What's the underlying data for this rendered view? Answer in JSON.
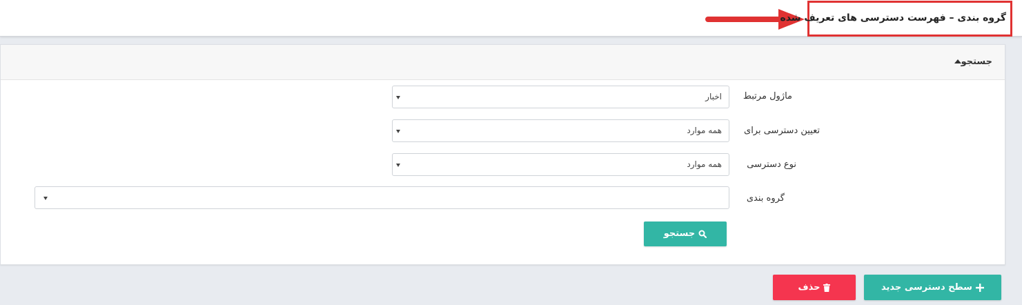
{
  "header": {
    "title": "گروه بندی – فهرست دسترسی های تعریف شده",
    "annotation_color": "#e03232"
  },
  "search_panel": {
    "title": "جستجو",
    "fields": [
      {
        "label": "ماژول مرتبط",
        "value": "اخبار"
      },
      {
        "label": "تعیین دسترسی برای",
        "value": "همه موارد"
      },
      {
        "label": "نوع دسترسی",
        "value": "همه موارد"
      },
      {
        "label": "گروه بندی",
        "value": ""
      }
    ],
    "search_button": "جستجو"
  },
  "actions": {
    "new_button": "سطح دسترسی جدید",
    "delete_button": "حذف"
  },
  "colors": {
    "teal": "#32b6a5",
    "red": "#f5354f"
  }
}
